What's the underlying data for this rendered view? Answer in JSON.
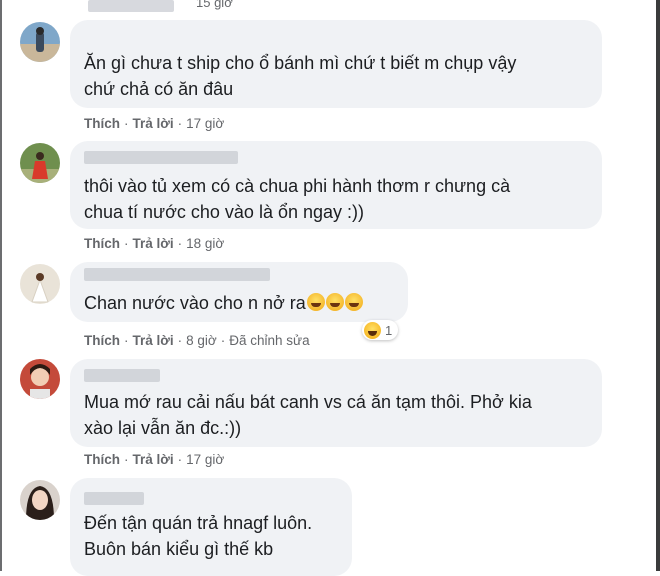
{
  "top": {
    "time": "15 giờ"
  },
  "actions": {
    "like": "Thích",
    "reply": "Trả lời",
    "separator": "·"
  },
  "comments": [
    {
      "avatar": "avatar-beach",
      "name": "",
      "lines": [
        "Ăn gì chưa t ship cho ổ bánh mì chứ t biết m chụp vậy",
        "chứ chả có ăn đâu"
      ],
      "time": "17 giờ"
    },
    {
      "avatar": "avatar-red-dress",
      "name": "",
      "lines": [
        "thôi vào tủ xem có cà chua phi hành thơm r chưng cà",
        "chua tí nước cho vào là ổn ngay :))"
      ],
      "time": "18 giờ"
    },
    {
      "avatar": "avatar-wedding",
      "name": "",
      "lines": [
        "Chan nước vào cho n nở ra"
      ],
      "emoji": [
        "laughing-emoji",
        "laughing-emoji",
        "laughing-emoji"
      ],
      "time": "8 giờ",
      "edited": "Đã chỉnh sửa",
      "reaction_count": "1",
      "reaction_icon": "haha-reaction-icon"
    },
    {
      "avatar": "avatar-girl",
      "name": "",
      "lines": [
        "Mua mớ rau cải nấu bát canh vs cá ăn tạm thôi. Phở kia",
        "xào lại vẫn ăn đc.:))"
      ],
      "time": "17 giờ"
    },
    {
      "avatar": "avatar-dark-hair",
      "name": "",
      "lines": [
        "Đến tận quán trả hnagf luôn.",
        "Buôn bán kiểu gì thế kb"
      ],
      "time": ""
    }
  ]
}
